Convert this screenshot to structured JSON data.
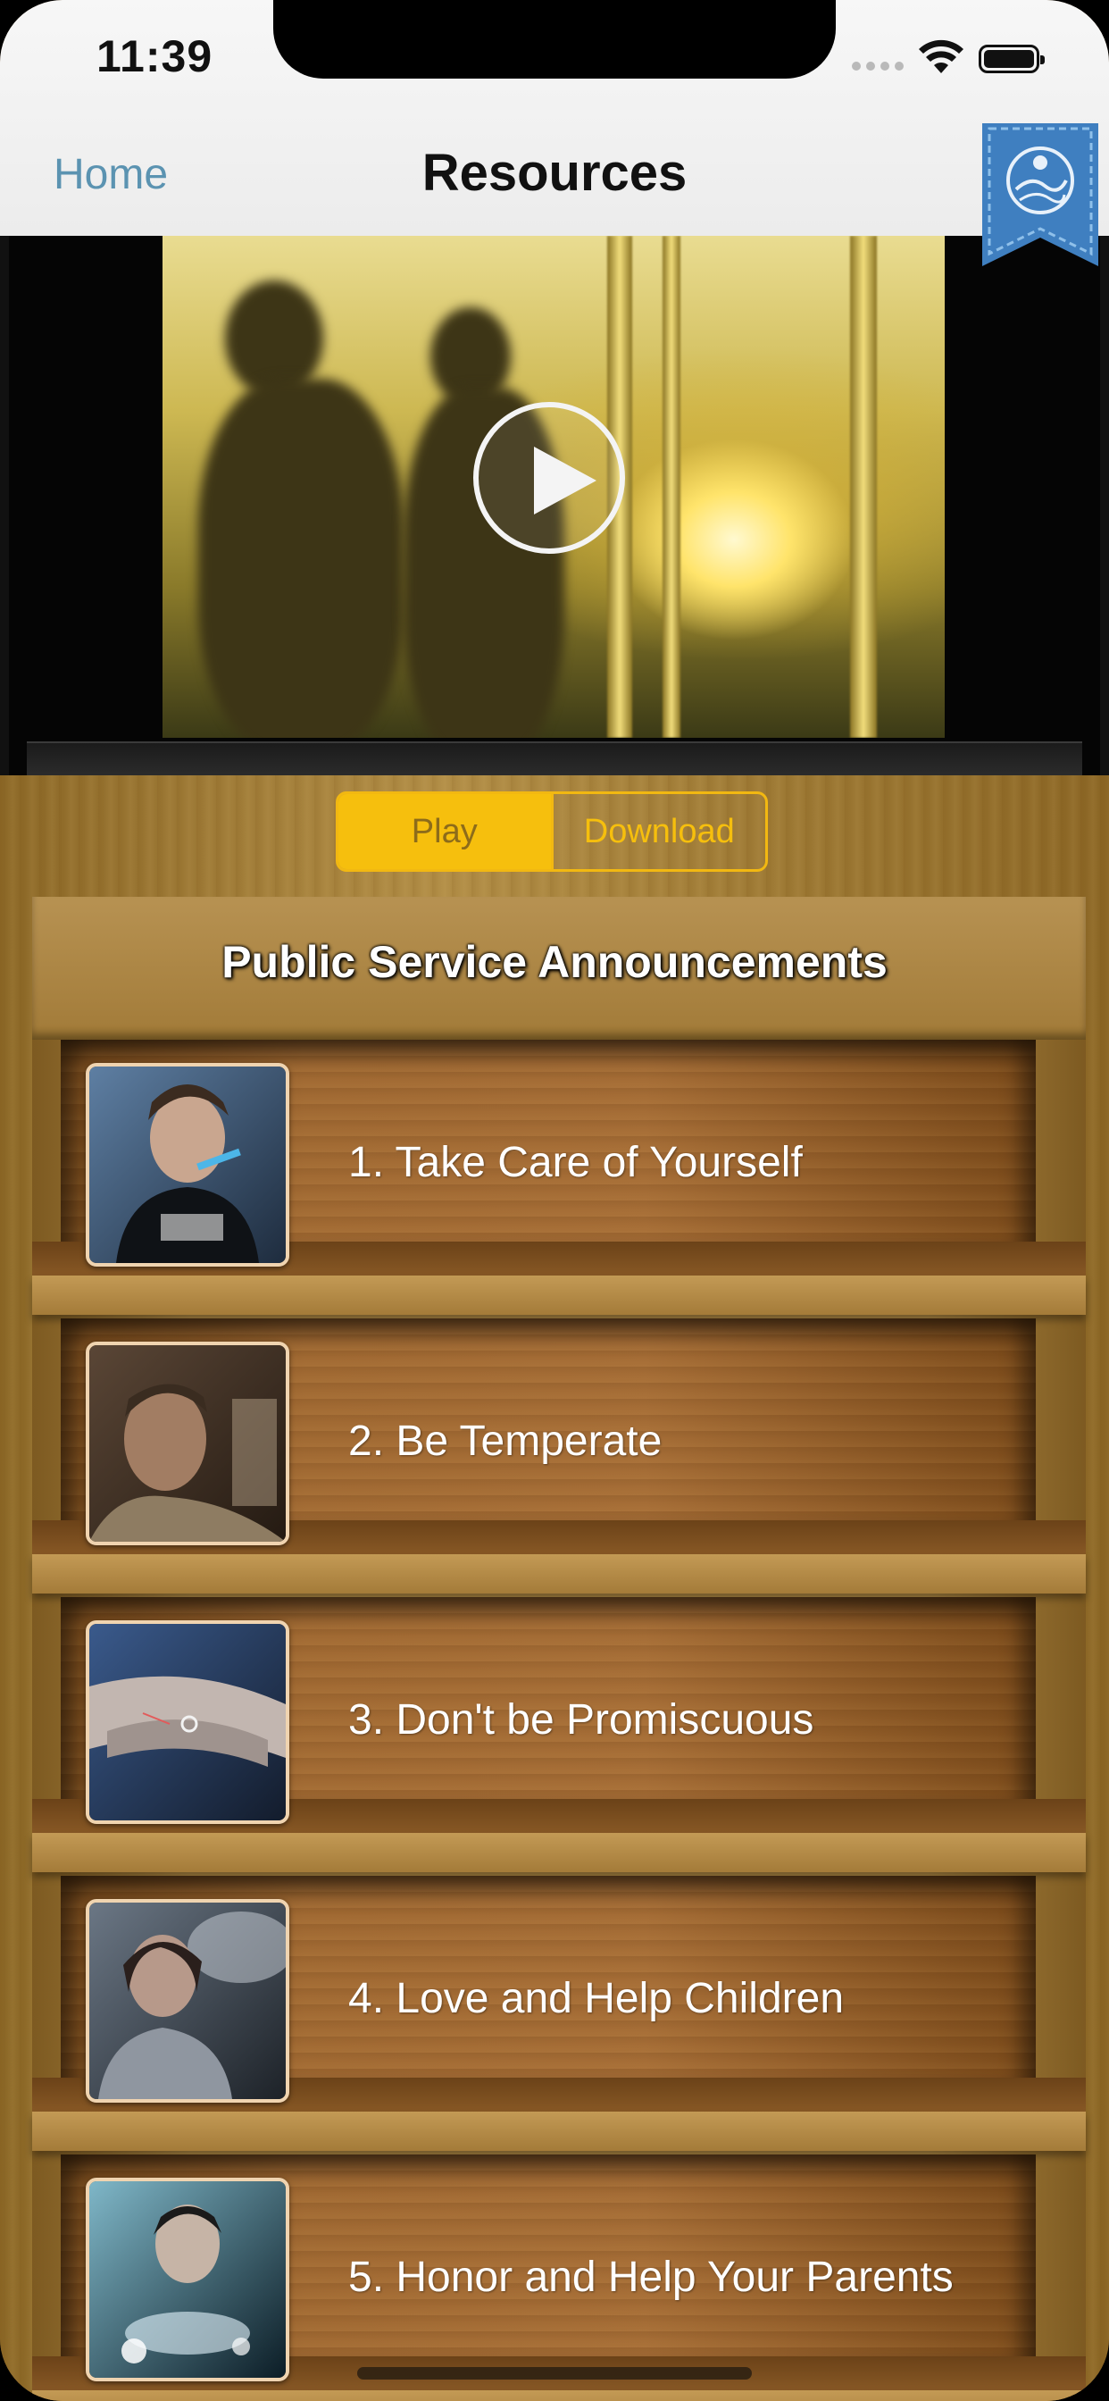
{
  "status_bar": {
    "time": "11:39"
  },
  "nav": {
    "back_label": "Home",
    "title": "Resources"
  },
  "video": {
    "state": "paused"
  },
  "segmented": {
    "play_label": "Play",
    "download_label": "Download",
    "selected": "Play"
  },
  "section": {
    "title": "Public Service Announcements"
  },
  "items": [
    {
      "label": "1. Take Care of Yourself"
    },
    {
      "label": "2. Be Temperate"
    },
    {
      "label": "3. Don't be Promiscuous"
    },
    {
      "label": "4. Love and Help Children"
    },
    {
      "label": "5. Honor and Help Your Parents"
    }
  ],
  "colors": {
    "accent": "#f6bf0d",
    "nav_link": "#5b93b1",
    "ribbon": "#3f7fc0"
  }
}
